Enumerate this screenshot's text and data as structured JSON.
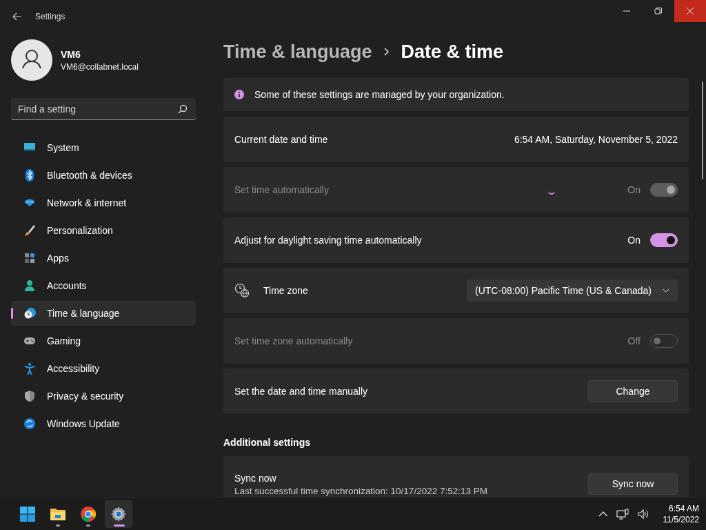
{
  "window": {
    "title": "Settings",
    "controls": [
      {
        "kind": "minimize",
        "highlighted": false
      },
      {
        "kind": "maximize",
        "highlighted": false
      },
      {
        "kind": "close",
        "highlighted": true
      }
    ]
  },
  "profile": {
    "name": "VM6",
    "email": "VM6@collabnet.local"
  },
  "search": {
    "placeholder": "Find a setting"
  },
  "sidebar": {
    "items": [
      {
        "label": "System",
        "kind": "system",
        "selected": false
      },
      {
        "label": "Bluetooth & devices",
        "kind": "bluetooth",
        "selected": false
      },
      {
        "label": "Network & internet",
        "kind": "network",
        "selected": false
      },
      {
        "label": "Personalization",
        "kind": "brush",
        "selected": false
      },
      {
        "label": "Apps",
        "kind": "apps",
        "selected": false
      },
      {
        "label": "Accounts",
        "kind": "accounts",
        "selected": false
      },
      {
        "label": "Time & language",
        "kind": "time",
        "selected": true
      },
      {
        "label": "Gaming",
        "kind": "gaming",
        "selected": false
      },
      {
        "label": "Accessibility",
        "kind": "accessibility",
        "selected": false
      },
      {
        "label": "Privacy & security",
        "kind": "shield",
        "selected": false
      },
      {
        "label": "Windows Update",
        "kind": "update",
        "selected": false
      }
    ]
  },
  "breadcrumb": [
    "Time & language",
    "Date & time"
  ],
  "rows": [
    {
      "kind": "info",
      "text": "Some of these settings are managed by your organization."
    },
    {
      "kind": "value",
      "label": "Current date and time",
      "value": "6:54 AM, Saturday, November 5, 2022"
    },
    {
      "kind": "toggle",
      "label": "Set time automatically",
      "disabled": true,
      "loading": true,
      "on": true,
      "state_text": "On"
    },
    {
      "kind": "toggle",
      "label": "Adjust for daylight saving time automatically",
      "disabled": false,
      "loading": false,
      "on": true,
      "state_text": "On"
    },
    {
      "kind": "dropdown",
      "label": "Time zone",
      "value": "(UTC-08:00) Pacific Time (US & Canada)"
    },
    {
      "kind": "toggle",
      "label": "Set time zone automatically",
      "disabled": true,
      "loading": false,
      "on": false,
      "state_text": "Off"
    },
    {
      "kind": "button",
      "label": "Set the date and time manually",
      "button": "Change"
    }
  ],
  "additional": {
    "heading": "Additional settings",
    "sync": {
      "title": "Sync now",
      "lines": [
        "Last successful time synchronization: 10/17/2022 7:52:13 PM"
      ],
      "button": "Sync now"
    }
  },
  "taskbar": {
    "apps": [
      {
        "kind": "start",
        "running": false,
        "selected": false
      },
      {
        "kind": "explorer",
        "running": true,
        "selected": false
      },
      {
        "kind": "chrome",
        "running": true,
        "selected": false
      },
      {
        "kind": "settings",
        "running": true,
        "selected": true
      }
    ],
    "time": "6:54 AM",
    "date": "11/5/2022"
  }
}
